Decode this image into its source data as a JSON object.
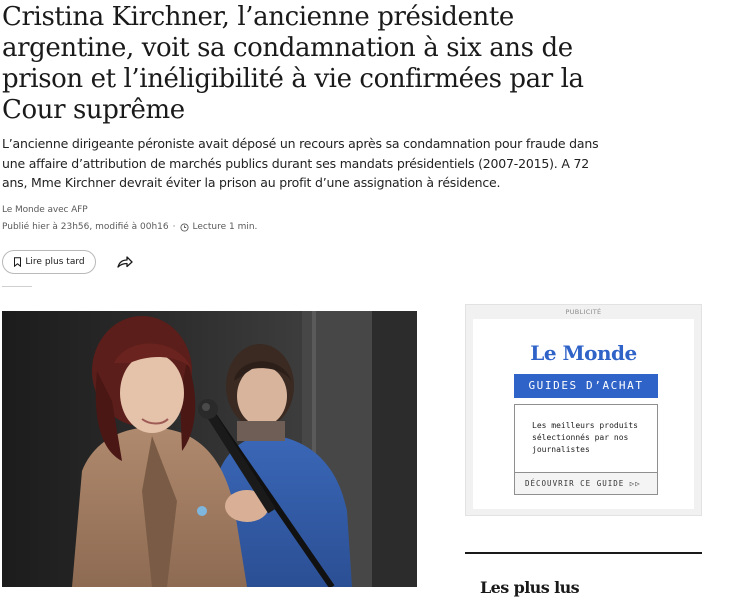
{
  "article": {
    "headline": "Cristina Kirchner, l’ancienne présidente argentine, voit sa condamnation à six ans de prison et l’inéligibilité à vie confirmées par la Cour suprême",
    "standfirst": "L’ancienne dirigeante péroniste avait déposé un recours après sa condamnation pour fraude dans une affaire d’attribution de marchés publics durant ses mandats présidentiels (2007-2015). A 72 ans, Mme Kirchner devrait éviter la prison au profit d’une assignation à résidence.",
    "byline": "Le Monde avec AFP",
    "published": "Publié hier à 23h56, modifié à 00h16",
    "separator": "·",
    "reading_time": "Lecture 1 min."
  },
  "actions": {
    "read_later_label": "Lire plus tard",
    "bookmark_icon": "bookmark-icon",
    "share_icon": "share-icon"
  },
  "ad": {
    "label": "PUBLICITÉ",
    "logo": "Le Monde",
    "guides": "GUIDES D’ACHAT",
    "body": "Les meilleurs produits sélectionnés par nos journalistes",
    "cta": "DÉCOUVRIR CE GUIDE ▷▷"
  },
  "sidebar": {
    "most_read_title": "Les plus lus"
  },
  "colors": {
    "accent_blue": "#2f63c8",
    "text": "#1a1a1a",
    "muted": "#5a5a5a"
  }
}
